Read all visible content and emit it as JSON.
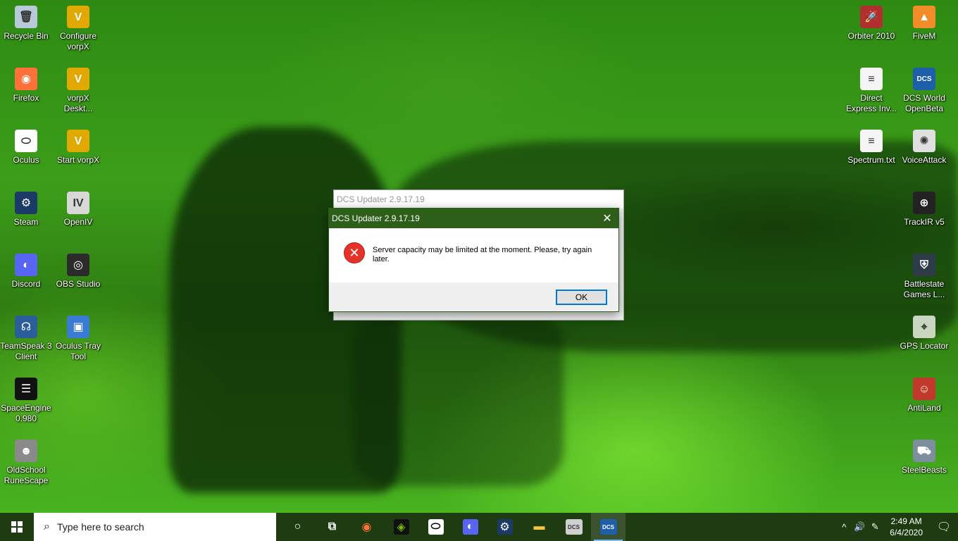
{
  "desktop": {
    "left_icons": [
      {
        "label": "Recycle Bin",
        "icon": "recycle-bin-icon",
        "glyph": "🗑",
        "color": "#b8c9d9"
      },
      {
        "label": "Configure vorpX",
        "icon": "vorpx-icon",
        "glyph": "V",
        "color": "#e0a800"
      },
      {
        "label": "Firefox",
        "icon": "firefox-icon",
        "glyph": "◉",
        "color": "#ff7139"
      },
      {
        "label": "vorpX Deskt...",
        "icon": "vorpx-desktop-icon",
        "glyph": "V",
        "color": "#e0a800"
      },
      {
        "label": "Oculus",
        "icon": "oculus-icon",
        "glyph": "⬭",
        "color": "#ffffff"
      },
      {
        "label": "Start vorpX",
        "icon": "vorpx-start-icon",
        "glyph": "V",
        "color": "#e0a800"
      },
      {
        "label": "Steam",
        "icon": "steam-icon",
        "glyph": "⚙",
        "color": "#1b3a66"
      },
      {
        "label": "OpenIV",
        "icon": "openiv-icon",
        "glyph": "IV",
        "color": "#d8d8d8"
      },
      {
        "label": "Discord",
        "icon": "discord-icon",
        "glyph": "◐",
        "color": "#5865f2"
      },
      {
        "label": "OBS Studio",
        "icon": "obs-icon",
        "glyph": "◎",
        "color": "#2b2b2b"
      },
      {
        "label": "TeamSpeak 3 Client",
        "icon": "teamspeak-icon",
        "glyph": "☊",
        "color": "#2b5f9c"
      },
      {
        "label": "Oculus Tray Tool",
        "icon": "oculus-tray-icon",
        "glyph": "▣",
        "color": "#3a7bd5"
      },
      {
        "label": "SpaceEngine 0.980",
        "icon": "spaceengine-icon",
        "glyph": "☰",
        "color": "#111111"
      },
      {
        "label": "OldSchool RuneScape",
        "icon": "runescape-icon",
        "glyph": "☻",
        "color": "#8a8a8a"
      }
    ],
    "right_icons": [
      {
        "label": "Orbiter 2010",
        "icon": "orbiter-icon",
        "glyph": "🚀",
        "color": "#b03030"
      },
      {
        "label": "FiveM",
        "icon": "fivem-icon",
        "glyph": "▲",
        "color": "#f28c28"
      },
      {
        "label": "Direct Express Inv...",
        "icon": "document-icon",
        "glyph": "≡",
        "color": "#f5f5f5"
      },
      {
        "label": "DCS World OpenBeta",
        "icon": "dcs-icon",
        "glyph": "DCS",
        "color": "#1d5fa8"
      },
      {
        "label": "Spectrum.txt",
        "icon": "text-file-icon",
        "glyph": "≡",
        "color": "#f5f5f5"
      },
      {
        "label": "VoiceAttack",
        "icon": "voiceattack-icon",
        "glyph": "✺",
        "color": "#e0e0e0"
      },
      {
        "label": "TrackIR v5",
        "icon": "trackir-icon",
        "glyph": "⊕",
        "color": "#222222"
      },
      {
        "label": "Battlestate Games L...",
        "icon": "battlestate-icon",
        "glyph": "⛨",
        "color": "#2d3a48"
      },
      {
        "label": "GPS Locator",
        "icon": "gps-locator-icon",
        "glyph": "⌖",
        "color": "#c9d6c0"
      },
      {
        "label": "AntiLand",
        "icon": "antiland-icon",
        "glyph": "☺",
        "color": "#c0392b"
      },
      {
        "label": "SteelBeasts",
        "icon": "steelbeasts-icon",
        "glyph": "⛟",
        "color": "#7d8f9c"
      }
    ]
  },
  "background_window": {
    "title": "DCS Updater 2.9.17.19"
  },
  "dialog": {
    "title": "DCS Updater 2.9.17.19",
    "message": "Server capacity may be limited at the moment. Please, try again later.",
    "ok_label": "OK"
  },
  "taskbar": {
    "search_placeholder": "Type here to search",
    "pinned": [
      {
        "name": "cortana-icon",
        "glyph": "○",
        "color": "#ffffff",
        "bg": "transparent",
        "active": false
      },
      {
        "name": "task-view-icon",
        "glyph": "⧉",
        "color": "#ffffff",
        "bg": "transparent",
        "active": false
      },
      {
        "name": "firefox-icon",
        "glyph": "◉",
        "color": "#ff7139",
        "bg": "transparent",
        "active": false
      },
      {
        "name": "nvidia-icon",
        "glyph": "◈",
        "color": "#76b900",
        "bg": "#111111",
        "active": false
      },
      {
        "name": "oculus-icon",
        "glyph": "⬭",
        "color": "#000000",
        "bg": "#ffffff",
        "active": false
      },
      {
        "name": "discord-icon",
        "glyph": "◐",
        "color": "#ffffff",
        "bg": "#5865f2",
        "active": false
      },
      {
        "name": "steam-icon",
        "glyph": "⚙",
        "color": "#ffffff",
        "bg": "#1b3a66",
        "active": false
      },
      {
        "name": "file-explorer-icon",
        "glyph": "▬",
        "color": "#f4c542",
        "bg": "transparent",
        "active": false
      },
      {
        "name": "dcs-updater-icon",
        "glyph": "DCS",
        "color": "#333333",
        "bg": "#cfcfcf",
        "active": false
      },
      {
        "name": "dcs-world-icon",
        "glyph": "DCS",
        "color": "#ffffff",
        "bg": "#1d5fa8",
        "active": true
      }
    ],
    "tray": {
      "chevron": "^",
      "volume": "🔊",
      "pen": "✎",
      "time": "2:49 AM",
      "date": "6/4/2020",
      "notification": "🗨"
    }
  }
}
